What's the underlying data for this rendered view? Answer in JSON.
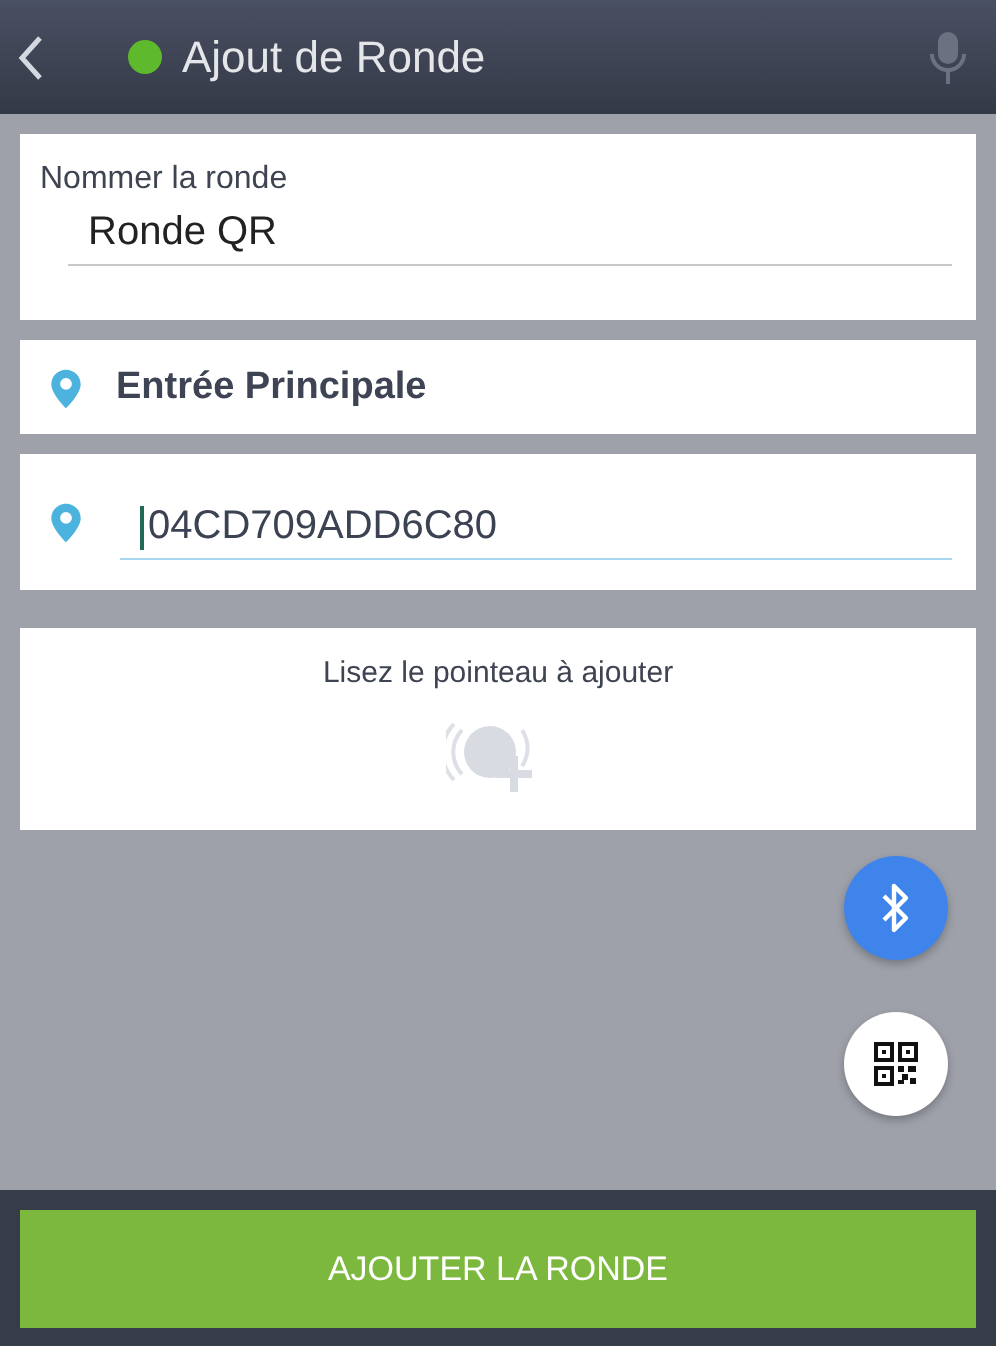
{
  "header": {
    "title": "Ajout de Ronde",
    "connected": true
  },
  "name_field": {
    "label": "Nommer la ronde",
    "value": "Ronde QR",
    "focused": false
  },
  "location": {
    "name": "Entrée Principale"
  },
  "tag_field": {
    "value": "04CD709ADD6C80",
    "focused": true
  },
  "scan_card": {
    "message": "Lisez le pointeau à ajouter"
  },
  "submit_button": {
    "label": "AJOUTER LA RONDE"
  }
}
